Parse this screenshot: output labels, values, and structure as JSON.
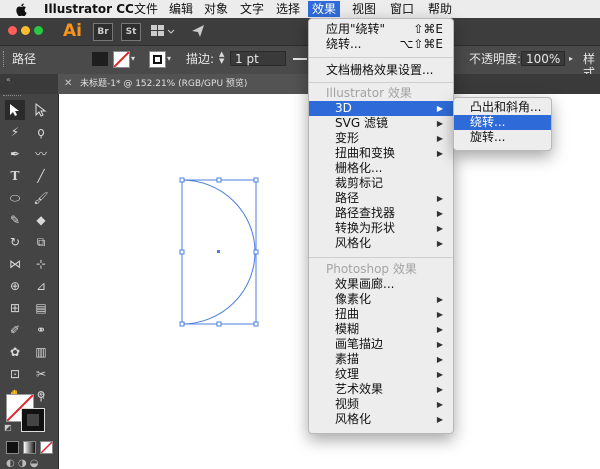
{
  "menubar": {
    "app": "Illustrator CC",
    "items": [
      "文件",
      "编辑",
      "对象",
      "文字",
      "选择",
      "效果",
      "视图",
      "窗口",
      "帮助"
    ]
  },
  "appbar": {
    "logo": "Ai",
    "br": "Br",
    "st": "St"
  },
  "control": {
    "path_label": "路径",
    "stroke_label": "描边:",
    "stroke_value": "1 pt",
    "opacity_label": "不透明度:",
    "opacity_value": "100%",
    "style_label": "样式"
  },
  "document": {
    "tab_title": "未标题-1* @ 152.21% (RGB/GPU 预览)"
  },
  "effect_menu": {
    "apply_last": "应用\"绕转\"",
    "apply_last_shortcut": "⇧⌘E",
    "last_effect": "绕转...",
    "last_effect_shortcut": "⌥⇧⌘E",
    "raster_settings": "文档栅格效果设置...",
    "illustrator_header": "Illustrator 效果",
    "illustrator_items": [
      "3D",
      "SVG 滤镜",
      "变形",
      "扭曲和变换",
      "栅格化...",
      "裁剪标记",
      "路径",
      "路径查找器",
      "转换为形状",
      "风格化"
    ],
    "photoshop_header": "Photoshop 效果",
    "photoshop_items": [
      "效果画廊...",
      "像素化",
      "扭曲",
      "模糊",
      "画笔描边",
      "素描",
      "纹理",
      "艺术效果",
      "视频",
      "风格化"
    ]
  },
  "submenu_3d": {
    "items": [
      "凸出和斜角...",
      "绕转...",
      "旋转..."
    ]
  },
  "colors": {
    "menu_highlight": "#2f6bd8",
    "selection": "#4a7fe0"
  },
  "icons": [
    "apple-icon",
    "arrow-icon",
    "direct-select-icon",
    "pen-icon",
    "type-icon",
    "brush-icon",
    "eraser-icon",
    "rotate-icon",
    "scale-icon",
    "eyedropper-icon",
    "graph-icon",
    "hand-icon",
    "zoom-icon"
  ]
}
